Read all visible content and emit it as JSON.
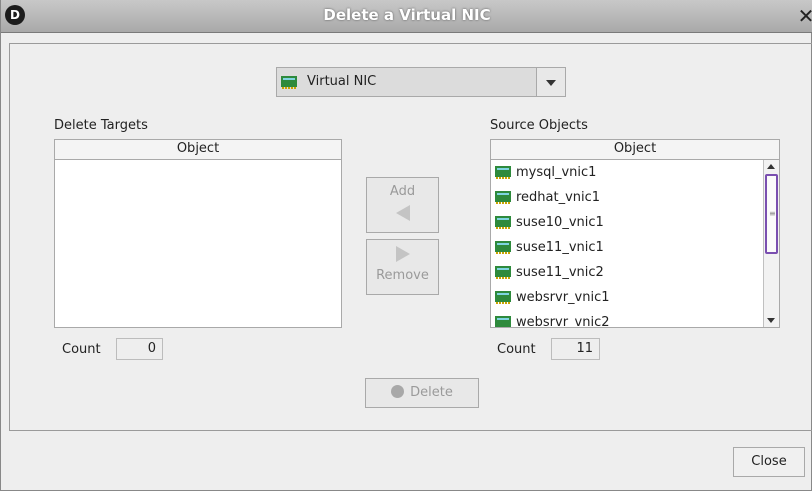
{
  "window": {
    "title": "Delete a Virtual NIC",
    "logo_letter": "D",
    "close_glyph": "✕"
  },
  "object_type": {
    "icon": "virtual-nic-icon",
    "selected": "Virtual NIC"
  },
  "targets": {
    "label": "Delete Targets",
    "column_header": "Object",
    "items": [],
    "count_label": "Count",
    "count": "0"
  },
  "source": {
    "label": "Source Objects",
    "column_header": "Object",
    "items": [
      "mysql_vnic1",
      "redhat_vnic1",
      "suse10_vnic1",
      "suse11_vnic1",
      "suse11_vnic2",
      "websrvr_vnic1",
      "websrvr_vnic2"
    ],
    "count_label": "Count",
    "count": "11"
  },
  "buttons": {
    "add": "Add",
    "remove": "Remove",
    "delete": "Delete",
    "close": "Close"
  },
  "colors": {
    "title_bar": "#a9a9a9",
    "nic_icon": "#2e8a3c",
    "scroll_thumb_border": "#7a4fb0"
  }
}
